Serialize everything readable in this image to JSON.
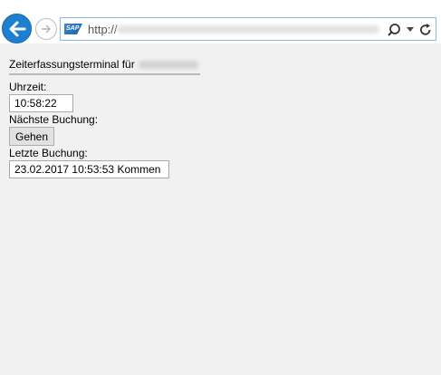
{
  "browser": {
    "url_prefix": "http://",
    "address_bar_icon": "sap-logo",
    "search_icon": "search-icon",
    "dropdown_icon": "chevron-down-icon",
    "refresh_icon": "refresh-icon"
  },
  "page": {
    "title_prefix": "Zeiterfassungsterminal für",
    "time_label": "Uhrzeit:",
    "time_value": "10:58:22",
    "next_booking_label": "Nächste Buchung:",
    "next_booking_button": "Gehen",
    "last_booking_label": "Letzte Buchung:",
    "last_booking_value": "23.02.2017 10:53:53 Kommen"
  },
  "colors": {
    "back_button": "#1e7fd1",
    "page_background": "#f1f1f1"
  }
}
